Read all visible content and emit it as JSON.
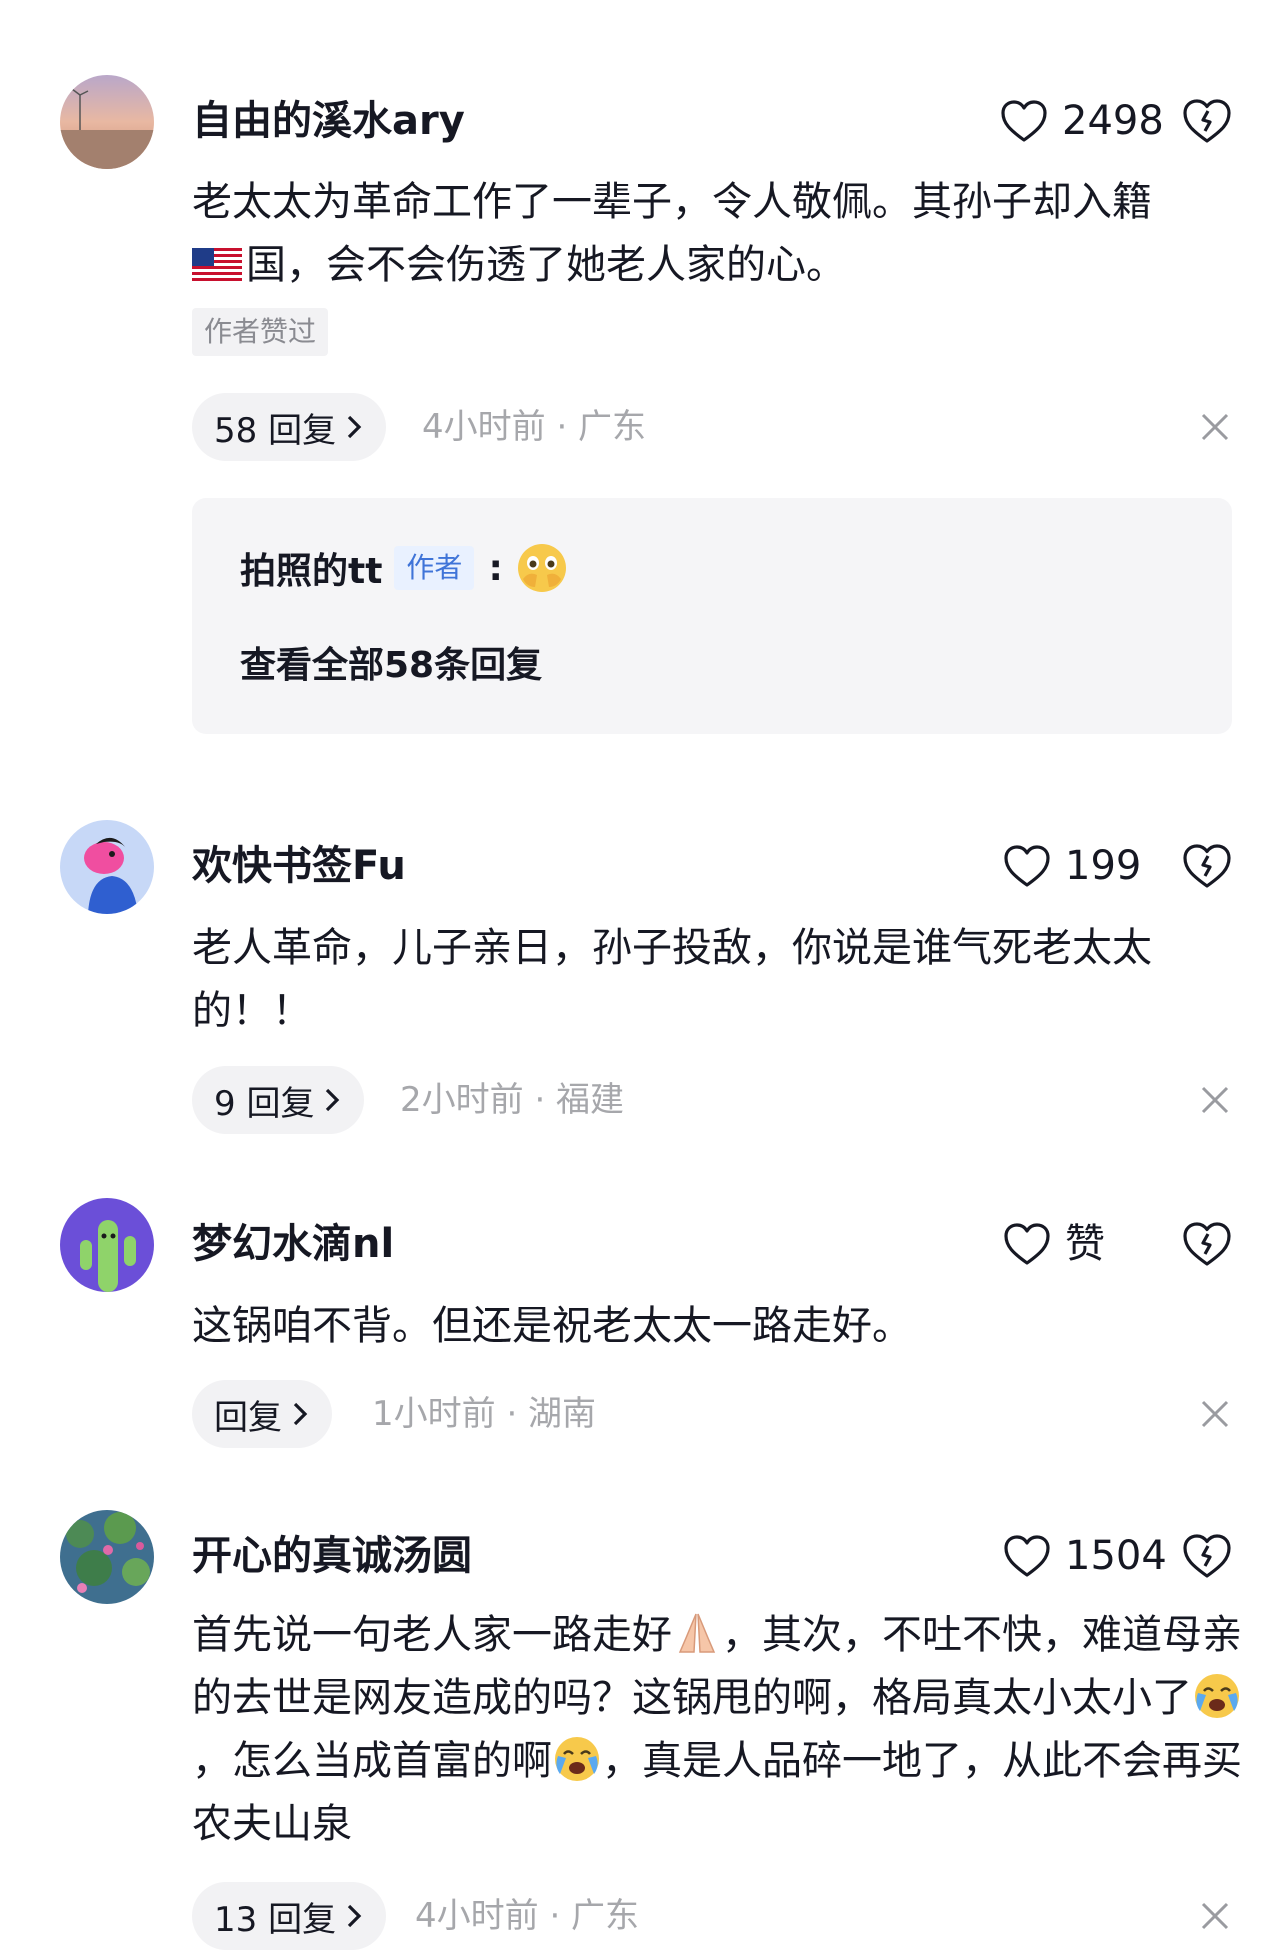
{
  "comments": [
    {
      "username": "自由的溪水ary",
      "likes": "2498",
      "text_after_flag": "老太太为革命工作了一辈子，令人敬佩。其孙子却入籍",
      "text_line2": "国，会不会伤透了她老人家的心。",
      "author_liked": "作者赞过",
      "reply_count": "58 回复",
      "meta": "4小时前 · 广东",
      "reply_preview": {
        "name": "拍照的tt",
        "tag": "作者",
        "colon": ":",
        "view_all": "查看全部58条回复"
      }
    },
    {
      "username": "欢快书签Fu",
      "likes": "199",
      "text": "老人革命，儿子亲日，孙子投敌，你说是谁气死老太太的！！",
      "reply_count": "9 回复",
      "meta": "2小时前 · 福建"
    },
    {
      "username": "梦幻水滴nl",
      "likes": "赞",
      "text": "这锅咱不背。但还是祝老太太一路走好。",
      "reply_count": "回复",
      "meta": "1小时前 · 湖南"
    },
    {
      "username": "开心的真诚汤圆",
      "likes": "1504",
      "text_a": "首先说一句老人家一路走好",
      "text_b": "，其次，不吐不快，难道母亲的去世是网友造成的吗？这锅甩的啊，格局真太小太小了",
      "text_c": "，怎么当成首富的啊",
      "text_d": "，真是人品碎一地了，从此不会再买农夫山泉",
      "reply_count": "13 回复",
      "meta": "4小时前 · 广东"
    }
  ],
  "icons": {
    "like": "heart-outline-icon",
    "dislike": "broken-heart-icon",
    "close": "close-icon",
    "chevron": "chevron-right-icon"
  },
  "colors": {
    "text": "#161823",
    "meta": "#a6a7ab",
    "pill_bg": "#f2f2f4",
    "author_tag": "#3f74d8"
  }
}
